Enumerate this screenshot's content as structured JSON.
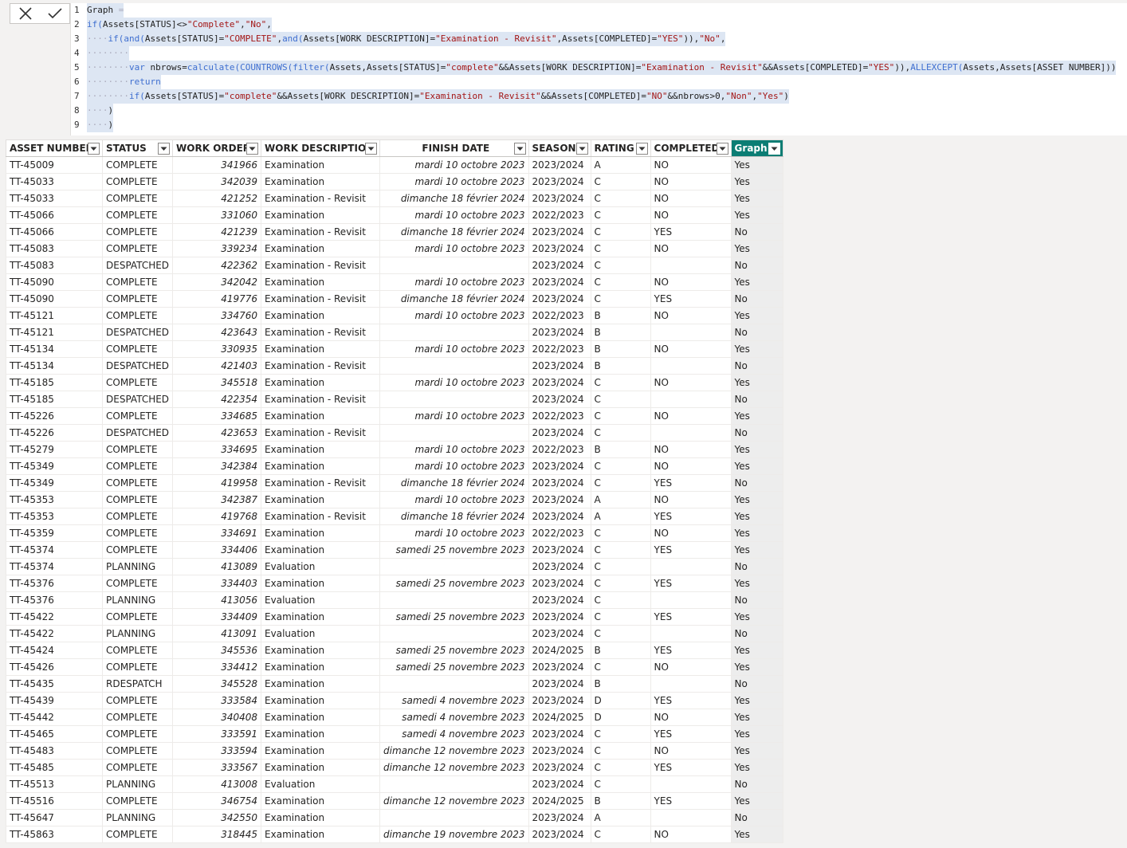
{
  "formula": {
    "lines": [
      {
        "n": "1",
        "tokens": [
          [
            "pl",
            "Graph"
          ],
          [
            "dot",
            " ="
          ]
        ]
      },
      {
        "n": "2",
        "tokens": [
          [
            "kw",
            "if("
          ],
          [
            "pl",
            "Assets[STATUS]<>"
          ],
          [
            "str",
            "\"Complete\""
          ],
          [
            "pl",
            ","
          ],
          [
            "str",
            "\"No\""
          ],
          [
            "pl",
            ","
          ]
        ]
      },
      {
        "n": "3",
        "tokens": [
          [
            "dot",
            "····"
          ],
          [
            "kw",
            "if(and("
          ],
          [
            "pl",
            "Assets[STATUS]="
          ],
          [
            "str",
            "\"COMPLETE\""
          ],
          [
            "pl",
            ","
          ],
          [
            "kw",
            "and("
          ],
          [
            "pl",
            "Assets[WORK DESCRIPTION]="
          ],
          [
            "str",
            "\"Examination - Revisit\""
          ],
          [
            "pl",
            ",Assets[COMPLETED]="
          ],
          [
            "str",
            "\"YES\""
          ],
          [
            "pl",
            ")),"
          ],
          [
            "str",
            "\"No\""
          ],
          [
            "pl",
            ","
          ]
        ]
      },
      {
        "n": "4",
        "tokens": [
          [
            "dot",
            "········"
          ]
        ]
      },
      {
        "n": "5",
        "tokens": [
          [
            "dot",
            "········"
          ],
          [
            "kw",
            "var"
          ],
          [
            "pl",
            " nbrows="
          ],
          [
            "kw",
            "calculate(COUNTROWS(filter("
          ],
          [
            "pl",
            "Assets,Assets[STATUS]="
          ],
          [
            "str",
            "\"complete\""
          ],
          [
            "pl",
            "&&Assets[WORK DESCRIPTION]="
          ],
          [
            "str",
            "\"Examination - Revisit\""
          ],
          [
            "pl",
            "&&Assets[COMPLETED]="
          ],
          [
            "str",
            "\"YES\""
          ],
          [
            "pl",
            ")),"
          ],
          [
            "kw",
            "ALLEXCEPT("
          ],
          [
            "pl",
            "Assets,Assets[ASSET NUMBER]))"
          ]
        ]
      },
      {
        "n": "6",
        "tokens": [
          [
            "dot",
            "········"
          ],
          [
            "kw",
            "return"
          ]
        ]
      },
      {
        "n": "7",
        "tokens": [
          [
            "dot",
            "········"
          ],
          [
            "kw",
            "if("
          ],
          [
            "pl",
            "Assets[STATUS]="
          ],
          [
            "str",
            "\"complete\""
          ],
          [
            "pl",
            "&&Assets[WORK DESCRIPTION]="
          ],
          [
            "str",
            "\"Examination - Revisit\""
          ],
          [
            "pl",
            "&&Assets[COMPLETED]="
          ],
          [
            "str",
            "\"NO\""
          ],
          [
            "pl",
            "&&nbrows>0,"
          ],
          [
            "str",
            "\"Non\""
          ],
          [
            "pl",
            ","
          ],
          [
            "str",
            "\"Yes\""
          ],
          [
            "pl",
            ")"
          ]
        ]
      },
      {
        "n": "8",
        "tokens": [
          [
            "dot",
            "····"
          ],
          [
            "pl",
            ")"
          ]
        ]
      },
      {
        "n": "9",
        "tokens": [
          [
            "dot",
            "····"
          ],
          [
            "pl",
            ")"
          ]
        ]
      }
    ]
  },
  "table": {
    "columns": [
      "ASSET NUMBER",
      "STATUS",
      "WORK ORDER",
      "WORK DESCRIPTION",
      "FINISH DATE",
      "SEASON",
      "RATING",
      "COMPLETED",
      "Graph"
    ],
    "rows": [
      [
        "TT-45009",
        "COMPLETE",
        "341966",
        "Examination",
        "mardi 10 octobre 2023",
        "2023/2024",
        "A",
        "NO",
        "Yes"
      ],
      [
        "TT-45033",
        "COMPLETE",
        "342039",
        "Examination",
        "mardi 10 octobre 2023",
        "2023/2024",
        "C",
        "NO",
        "Yes"
      ],
      [
        "TT-45033",
        "COMPLETE",
        "421252",
        "Examination - Revisit",
        "dimanche 18 février 2024",
        "2023/2024",
        "C",
        "NO",
        "Yes"
      ],
      [
        "TT-45066",
        "COMPLETE",
        "331060",
        "Examination",
        "mardi 10 octobre 2023",
        "2022/2023",
        "C",
        "NO",
        "Yes"
      ],
      [
        "TT-45066",
        "COMPLETE",
        "421239",
        "Examination - Revisit",
        "dimanche 18 février 2024",
        "2023/2024",
        "C",
        "YES",
        "No"
      ],
      [
        "TT-45083",
        "COMPLETE",
        "339234",
        "Examination",
        "mardi 10 octobre 2023",
        "2023/2024",
        "C",
        "NO",
        "Yes"
      ],
      [
        "TT-45083",
        "DESPATCHED",
        "422362",
        "Examination - Revisit",
        "",
        "2023/2024",
        "C",
        "",
        "No"
      ],
      [
        "TT-45090",
        "COMPLETE",
        "342042",
        "Examination",
        "mardi 10 octobre 2023",
        "2023/2024",
        "C",
        "NO",
        "Yes"
      ],
      [
        "TT-45090",
        "COMPLETE",
        "419776",
        "Examination - Revisit",
        "dimanche 18 février 2024",
        "2023/2024",
        "C",
        "YES",
        "No"
      ],
      [
        "TT-45121",
        "COMPLETE",
        "334760",
        "Examination",
        "mardi 10 octobre 2023",
        "2022/2023",
        "B",
        "NO",
        "Yes"
      ],
      [
        "TT-45121",
        "DESPATCHED",
        "423643",
        "Examination - Revisit",
        "",
        "2023/2024",
        "B",
        "",
        "No"
      ],
      [
        "TT-45134",
        "COMPLETE",
        "330935",
        "Examination",
        "mardi 10 octobre 2023",
        "2022/2023",
        "B",
        "NO",
        "Yes"
      ],
      [
        "TT-45134",
        "DESPATCHED",
        "421403",
        "Examination - Revisit",
        "",
        "2023/2024",
        "B",
        "",
        "No"
      ],
      [
        "TT-45185",
        "COMPLETE",
        "345518",
        "Examination",
        "mardi 10 octobre 2023",
        "2023/2024",
        "C",
        "NO",
        "Yes"
      ],
      [
        "TT-45185",
        "DESPATCHED",
        "422354",
        "Examination - Revisit",
        "",
        "2023/2024",
        "C",
        "",
        "No"
      ],
      [
        "TT-45226",
        "COMPLETE",
        "334685",
        "Examination",
        "mardi 10 octobre 2023",
        "2022/2023",
        "C",
        "NO",
        "Yes"
      ],
      [
        "TT-45226",
        "DESPATCHED",
        "423653",
        "Examination - Revisit",
        "",
        "2023/2024",
        "C",
        "",
        "No"
      ],
      [
        "TT-45279",
        "COMPLETE",
        "334695",
        "Examination",
        "mardi 10 octobre 2023",
        "2022/2023",
        "B",
        "NO",
        "Yes"
      ],
      [
        "TT-45349",
        "COMPLETE",
        "342384",
        "Examination",
        "mardi 10 octobre 2023",
        "2023/2024",
        "C",
        "NO",
        "Yes"
      ],
      [
        "TT-45349",
        "COMPLETE",
        "419958",
        "Examination - Revisit",
        "dimanche 18 février 2024",
        "2023/2024",
        "C",
        "YES",
        "No"
      ],
      [
        "TT-45353",
        "COMPLETE",
        "342387",
        "Examination",
        "mardi 10 octobre 2023",
        "2023/2024",
        "A",
        "NO",
        "Yes"
      ],
      [
        "TT-45353",
        "COMPLETE",
        "419768",
        "Examination - Revisit",
        "dimanche 18 février 2024",
        "2023/2024",
        "A",
        "YES",
        "Yes"
      ],
      [
        "TT-45359",
        "COMPLETE",
        "334691",
        "Examination",
        "mardi 10 octobre 2023",
        "2022/2023",
        "C",
        "NO",
        "Yes"
      ],
      [
        "TT-45374",
        "COMPLETE",
        "334406",
        "Examination",
        "samedi 25 novembre 2023",
        "2023/2024",
        "C",
        "YES",
        "Yes"
      ],
      [
        "TT-45374",
        "PLANNING",
        "413089",
        "Evaluation",
        "",
        "2023/2024",
        "C",
        "",
        "No"
      ],
      [
        "TT-45376",
        "COMPLETE",
        "334403",
        "Examination",
        "samedi 25 novembre 2023",
        "2023/2024",
        "C",
        "YES",
        "Yes"
      ],
      [
        "TT-45376",
        "PLANNING",
        "413056",
        "Evaluation",
        "",
        "2023/2024",
        "C",
        "",
        "No"
      ],
      [
        "TT-45422",
        "COMPLETE",
        "334409",
        "Examination",
        "samedi 25 novembre 2023",
        "2023/2024",
        "C",
        "YES",
        "Yes"
      ],
      [
        "TT-45422",
        "PLANNING",
        "413091",
        "Evaluation",
        "",
        "2023/2024",
        "C",
        "",
        "No"
      ],
      [
        "TT-45424",
        "COMPLETE",
        "345536",
        "Examination",
        "samedi 25 novembre 2023",
        "2024/2025",
        "B",
        "YES",
        "Yes"
      ],
      [
        "TT-45426",
        "COMPLETE",
        "334412",
        "Examination",
        "samedi 25 novembre 2023",
        "2023/2024",
        "C",
        "NO",
        "Yes"
      ],
      [
        "TT-45435",
        "RDESPATCH",
        "345528",
        "Examination",
        "",
        "2023/2024",
        "B",
        "",
        "No"
      ],
      [
        "TT-45439",
        "COMPLETE",
        "333584",
        "Examination",
        "samedi 4 novembre 2023",
        "2023/2024",
        "D",
        "YES",
        "Yes"
      ],
      [
        "TT-45442",
        "COMPLETE",
        "340408",
        "Examination",
        "samedi 4 novembre 2023",
        "2024/2025",
        "D",
        "NO",
        "Yes"
      ],
      [
        "TT-45465",
        "COMPLETE",
        "333591",
        "Examination",
        "samedi 4 novembre 2023",
        "2023/2024",
        "C",
        "YES",
        "Yes"
      ],
      [
        "TT-45483",
        "COMPLETE",
        "333594",
        "Examination",
        "dimanche 12 novembre 2023",
        "2023/2024",
        "C",
        "NO",
        "Yes"
      ],
      [
        "TT-45485",
        "COMPLETE",
        "333567",
        "Examination",
        "dimanche 12 novembre 2023",
        "2023/2024",
        "C",
        "YES",
        "Yes"
      ],
      [
        "TT-45513",
        "PLANNING",
        "413008",
        "Evaluation",
        "",
        "2023/2024",
        "C",
        "",
        "No"
      ],
      [
        "TT-45516",
        "COMPLETE",
        "346754",
        "Examination",
        "dimanche 12 novembre 2023",
        "2024/2025",
        "B",
        "YES",
        "Yes"
      ],
      [
        "TT-45647",
        "PLANNING",
        "342550",
        "Examination",
        "",
        "2023/2024",
        "A",
        "",
        "No"
      ],
      [
        "TT-45863",
        "COMPLETE",
        "318445",
        "Examination",
        "dimanche 19 novembre 2023",
        "2023/2024",
        "C",
        "NO",
        "Yes"
      ]
    ]
  },
  "icons": {
    "cancel": "close-icon",
    "commit": "checkmark-icon",
    "filter": "dropdown-filter-icon"
  },
  "colors": {
    "graph_header_bg": "#0b7d74",
    "graph_col_bg": "#ededed",
    "keyword": "#3f6fd0",
    "string": "#a31515"
  }
}
